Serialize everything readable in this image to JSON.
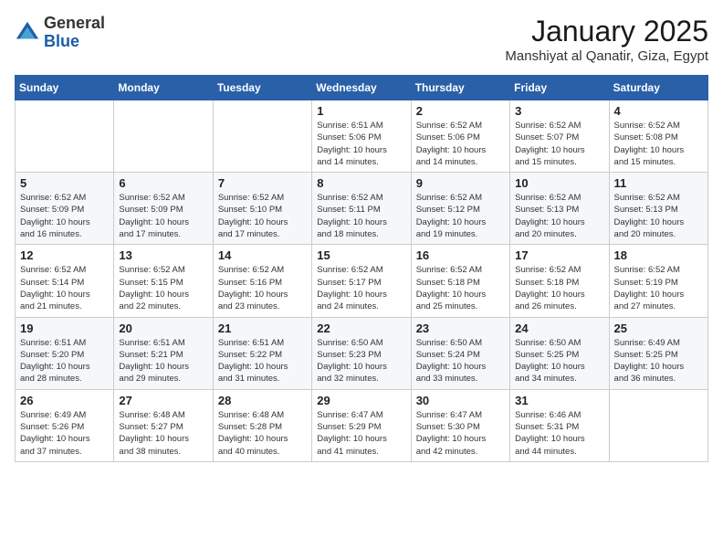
{
  "header": {
    "logo": {
      "general": "General",
      "blue": "Blue"
    },
    "title": "January 2025",
    "subtitle": "Manshiyat al Qanatir, Giza, Egypt"
  },
  "weekdays": [
    "Sunday",
    "Monday",
    "Tuesday",
    "Wednesday",
    "Thursday",
    "Friday",
    "Saturday"
  ],
  "weeks": [
    [
      {
        "day": "",
        "info": ""
      },
      {
        "day": "",
        "info": ""
      },
      {
        "day": "",
        "info": ""
      },
      {
        "day": "1",
        "info": "Sunrise: 6:51 AM\nSunset: 5:06 PM\nDaylight: 10 hours\nand 14 minutes."
      },
      {
        "day": "2",
        "info": "Sunrise: 6:52 AM\nSunset: 5:06 PM\nDaylight: 10 hours\nand 14 minutes."
      },
      {
        "day": "3",
        "info": "Sunrise: 6:52 AM\nSunset: 5:07 PM\nDaylight: 10 hours\nand 15 minutes."
      },
      {
        "day": "4",
        "info": "Sunrise: 6:52 AM\nSunset: 5:08 PM\nDaylight: 10 hours\nand 15 minutes."
      }
    ],
    [
      {
        "day": "5",
        "info": "Sunrise: 6:52 AM\nSunset: 5:09 PM\nDaylight: 10 hours\nand 16 minutes."
      },
      {
        "day": "6",
        "info": "Sunrise: 6:52 AM\nSunset: 5:09 PM\nDaylight: 10 hours\nand 17 minutes."
      },
      {
        "day": "7",
        "info": "Sunrise: 6:52 AM\nSunset: 5:10 PM\nDaylight: 10 hours\nand 17 minutes."
      },
      {
        "day": "8",
        "info": "Sunrise: 6:52 AM\nSunset: 5:11 PM\nDaylight: 10 hours\nand 18 minutes."
      },
      {
        "day": "9",
        "info": "Sunrise: 6:52 AM\nSunset: 5:12 PM\nDaylight: 10 hours\nand 19 minutes."
      },
      {
        "day": "10",
        "info": "Sunrise: 6:52 AM\nSunset: 5:13 PM\nDaylight: 10 hours\nand 20 minutes."
      },
      {
        "day": "11",
        "info": "Sunrise: 6:52 AM\nSunset: 5:13 PM\nDaylight: 10 hours\nand 20 minutes."
      }
    ],
    [
      {
        "day": "12",
        "info": "Sunrise: 6:52 AM\nSunset: 5:14 PM\nDaylight: 10 hours\nand 21 minutes."
      },
      {
        "day": "13",
        "info": "Sunrise: 6:52 AM\nSunset: 5:15 PM\nDaylight: 10 hours\nand 22 minutes."
      },
      {
        "day": "14",
        "info": "Sunrise: 6:52 AM\nSunset: 5:16 PM\nDaylight: 10 hours\nand 23 minutes."
      },
      {
        "day": "15",
        "info": "Sunrise: 6:52 AM\nSunset: 5:17 PM\nDaylight: 10 hours\nand 24 minutes."
      },
      {
        "day": "16",
        "info": "Sunrise: 6:52 AM\nSunset: 5:18 PM\nDaylight: 10 hours\nand 25 minutes."
      },
      {
        "day": "17",
        "info": "Sunrise: 6:52 AM\nSunset: 5:18 PM\nDaylight: 10 hours\nand 26 minutes."
      },
      {
        "day": "18",
        "info": "Sunrise: 6:52 AM\nSunset: 5:19 PM\nDaylight: 10 hours\nand 27 minutes."
      }
    ],
    [
      {
        "day": "19",
        "info": "Sunrise: 6:51 AM\nSunset: 5:20 PM\nDaylight: 10 hours\nand 28 minutes."
      },
      {
        "day": "20",
        "info": "Sunrise: 6:51 AM\nSunset: 5:21 PM\nDaylight: 10 hours\nand 29 minutes."
      },
      {
        "day": "21",
        "info": "Sunrise: 6:51 AM\nSunset: 5:22 PM\nDaylight: 10 hours\nand 31 minutes."
      },
      {
        "day": "22",
        "info": "Sunrise: 6:50 AM\nSunset: 5:23 PM\nDaylight: 10 hours\nand 32 minutes."
      },
      {
        "day": "23",
        "info": "Sunrise: 6:50 AM\nSunset: 5:24 PM\nDaylight: 10 hours\nand 33 minutes."
      },
      {
        "day": "24",
        "info": "Sunrise: 6:50 AM\nSunset: 5:25 PM\nDaylight: 10 hours\nand 34 minutes."
      },
      {
        "day": "25",
        "info": "Sunrise: 6:49 AM\nSunset: 5:25 PM\nDaylight: 10 hours\nand 36 minutes."
      }
    ],
    [
      {
        "day": "26",
        "info": "Sunrise: 6:49 AM\nSunset: 5:26 PM\nDaylight: 10 hours\nand 37 minutes."
      },
      {
        "day": "27",
        "info": "Sunrise: 6:48 AM\nSunset: 5:27 PM\nDaylight: 10 hours\nand 38 minutes."
      },
      {
        "day": "28",
        "info": "Sunrise: 6:48 AM\nSunset: 5:28 PM\nDaylight: 10 hours\nand 40 minutes."
      },
      {
        "day": "29",
        "info": "Sunrise: 6:47 AM\nSunset: 5:29 PM\nDaylight: 10 hours\nand 41 minutes."
      },
      {
        "day": "30",
        "info": "Sunrise: 6:47 AM\nSunset: 5:30 PM\nDaylight: 10 hours\nand 42 minutes."
      },
      {
        "day": "31",
        "info": "Sunrise: 6:46 AM\nSunset: 5:31 PM\nDaylight: 10 hours\nand 44 minutes."
      },
      {
        "day": "",
        "info": ""
      }
    ]
  ]
}
